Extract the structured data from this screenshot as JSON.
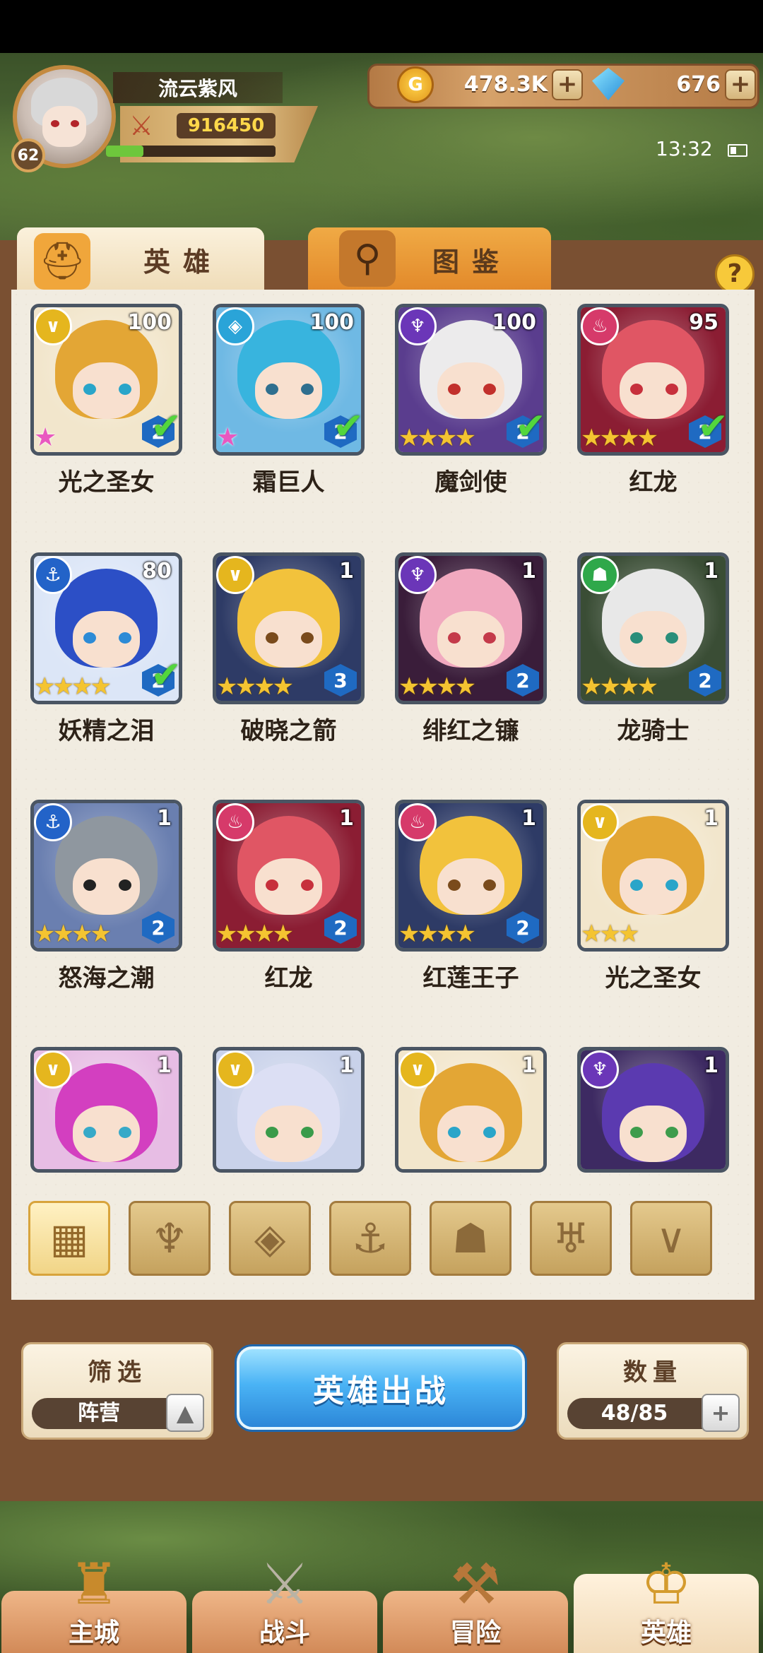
{
  "player": {
    "name": "流云紫风",
    "level": "62",
    "power": "916450",
    "exp_fraction": 0.22
  },
  "resources": {
    "gold": "478.3K",
    "gems": "676"
  },
  "status": {
    "time": "13:32"
  },
  "tabs": [
    {
      "label": "英雄",
      "active": true
    },
    {
      "label": "图鉴",
      "active": false
    }
  ],
  "heroes": [
    {
      "name": "光之圣女",
      "level": "100",
      "faction": "light",
      "stars": 1,
      "rainbow": true,
      "rank": "2",
      "check": true,
      "palette": "gold"
    },
    {
      "name": "霜巨人",
      "level": "100",
      "faction": "water",
      "stars": 1,
      "rainbow": true,
      "rank": "2",
      "check": true,
      "palette": "cyan"
    },
    {
      "name": "魔剑使",
      "level": "100",
      "faction": "dark",
      "stars": 4,
      "rainbow": false,
      "rank": "2",
      "check": true,
      "palette": "white"
    },
    {
      "name": "红龙",
      "level": "95",
      "faction": "fire",
      "stars": 4,
      "rainbow": false,
      "rank": "2",
      "check": true,
      "palette": "red"
    },
    {
      "name": "妖精之泪",
      "level": "80",
      "faction": "sea",
      "stars": 4,
      "rainbow": false,
      "rank": "2",
      "check": true,
      "palette": "blue"
    },
    {
      "name": "破晓之箭",
      "level": "1",
      "faction": "light",
      "stars": 4,
      "rainbow": false,
      "rank": "3",
      "check": false,
      "palette": "blond"
    },
    {
      "name": "绯红之镰",
      "level": "1",
      "faction": "dark",
      "stars": 4,
      "rainbow": false,
      "rank": "2",
      "check": false,
      "palette": "pink"
    },
    {
      "name": "龙骑士",
      "level": "1",
      "faction": "beast",
      "stars": 4,
      "rainbow": false,
      "rank": "2",
      "check": false,
      "palette": "silver"
    },
    {
      "name": "怒海之潮",
      "level": "1",
      "faction": "sea",
      "stars": 4,
      "rainbow": false,
      "rank": "2",
      "check": false,
      "palette": "knight"
    },
    {
      "name": "红龙",
      "level": "1",
      "faction": "fire",
      "stars": 4,
      "rainbow": false,
      "rank": "2",
      "check": false,
      "palette": "red"
    },
    {
      "name": "红莲王子",
      "level": "1",
      "faction": "fire",
      "stars": 4,
      "rainbow": false,
      "rank": "2",
      "check": false,
      "palette": "blond"
    },
    {
      "name": "光之圣女",
      "level": "1",
      "faction": "light",
      "stars": 3,
      "rainbow": false,
      "rank": "",
      "check": false,
      "palette": "gold"
    },
    {
      "name": "",
      "level": "1",
      "faction": "light",
      "stars": 0,
      "rainbow": false,
      "rank": "",
      "check": false,
      "palette": "magenta"
    },
    {
      "name": "",
      "level": "1",
      "faction": "light",
      "stars": 0,
      "rainbow": false,
      "rank": "",
      "check": false,
      "palette": "lavender"
    },
    {
      "name": "",
      "level": "1",
      "faction": "light",
      "stars": 0,
      "rainbow": false,
      "rank": "",
      "check": false,
      "palette": "gold"
    },
    {
      "name": "",
      "level": "1",
      "faction": "dark",
      "stars": 0,
      "rainbow": false,
      "rank": "",
      "check": false,
      "palette": "purple"
    }
  ],
  "filters": [
    {
      "icon": "grid-icon",
      "glyph": "▦",
      "active": true
    },
    {
      "icon": "fire-faction-icon",
      "glyph": "♆",
      "active": false
    },
    {
      "icon": "water-faction-icon",
      "glyph": "◈",
      "active": false
    },
    {
      "icon": "anchor-faction-icon",
      "glyph": "⚓",
      "active": false
    },
    {
      "icon": "beast-faction-icon",
      "glyph": "☗",
      "active": false
    },
    {
      "icon": "dark-faction-icon",
      "glyph": "♅",
      "active": false
    },
    {
      "icon": "light-faction-icon",
      "glyph": "∨",
      "active": false
    }
  ],
  "controls": {
    "filter_title": "筛选",
    "filter_value": "阵营",
    "deploy_label": "英雄出战",
    "count_title": "数量",
    "count_value": "48/85"
  },
  "nav": [
    {
      "label": "主城",
      "icon": "castle-icon",
      "active": false
    },
    {
      "label": "战斗",
      "icon": "crossed-swords-icon",
      "active": false
    },
    {
      "label": "冒险",
      "icon": "scroll-map-icon",
      "active": false
    },
    {
      "label": "英雄",
      "icon": "hero-helmet-icon",
      "active": true
    }
  ],
  "colors": {
    "light": "#e5b61e",
    "water": "#2aa4d8",
    "dark": "#6b36b8",
    "fire": "#d63a6a",
    "sea": "#2363c8",
    "beast": "#2fa84a"
  }
}
